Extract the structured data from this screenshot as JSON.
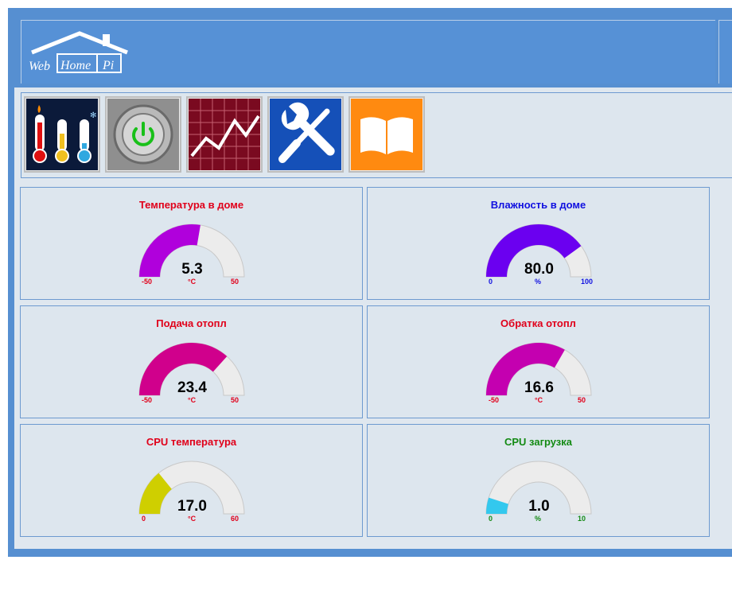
{
  "logo": {
    "word1": "Web",
    "word2": "Home",
    "word3": "Pi"
  },
  "toolbar": {
    "buttons": [
      {
        "name": "thermometers"
      },
      {
        "name": "power"
      },
      {
        "name": "chart"
      },
      {
        "name": "settings"
      },
      {
        "name": "book"
      }
    ]
  },
  "gauges": [
    {
      "title": "Температура в доме",
      "value": 5.3,
      "display": "5.3",
      "min": -50,
      "max": 50,
      "unit": "°C",
      "min_label": "-50",
      "max_label": "50",
      "fill_color": "#b000dc",
      "text_color": "#e0001a"
    },
    {
      "title": "Влажность в доме",
      "value": 80.0,
      "display": "80.0",
      "min": 0,
      "max": 100,
      "unit": "%",
      "min_label": "0",
      "max_label": "100",
      "fill_color": "#6b00f0",
      "text_color": "#1010e0"
    },
    {
      "title": "Подача отопл",
      "value": 23.4,
      "display": "23.4",
      "min": -50,
      "max": 50,
      "unit": "°C",
      "min_label": "-50",
      "max_label": "50",
      "fill_color": "#d0008c",
      "text_color": "#e0001a"
    },
    {
      "title": "Обратка отопл",
      "value": 16.6,
      "display": "16.6",
      "min": -50,
      "max": 50,
      "unit": "°C",
      "min_label": "-50",
      "max_label": "50",
      "fill_color": "#c400b0",
      "text_color": "#e0001a"
    },
    {
      "title": "CPU температура",
      "value": 17.0,
      "display": "17.0",
      "min": 0,
      "max": 60,
      "unit": "°C",
      "min_label": "0",
      "max_label": "60",
      "fill_color": "#cfcf00",
      "text_color": "#e0001a"
    },
    {
      "title": "CPU загрузка",
      "value": 1.0,
      "display": "1.0",
      "min": 0,
      "max": 10,
      "unit": "%",
      "min_label": "0",
      "max_label": "10",
      "fill_color": "#33c8ee",
      "text_color": "#138a13"
    }
  ]
}
